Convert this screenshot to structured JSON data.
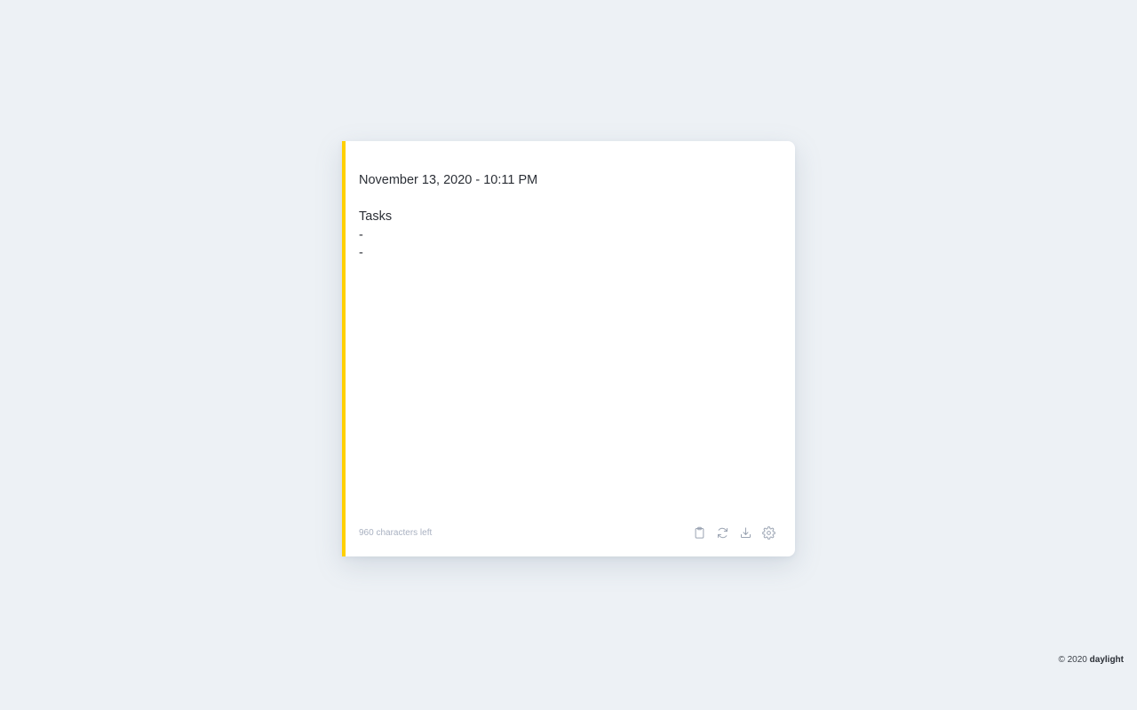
{
  "note": {
    "content": "November 13, 2020 - 10:11 PM\n\nTasks\n-\n-",
    "chars_left": "960 characters left",
    "accent_color": "#ffd000"
  },
  "toolbar": {
    "buttons": [
      {
        "name": "copy-button",
        "icon": "clipboard-icon"
      },
      {
        "name": "refresh-button",
        "icon": "refresh-icon"
      },
      {
        "name": "download-button",
        "icon": "download-icon"
      },
      {
        "name": "settings-button",
        "icon": "gear-icon"
      }
    ]
  },
  "footer": {
    "copyright_prefix": "© 2020",
    "brand": "daylight"
  }
}
